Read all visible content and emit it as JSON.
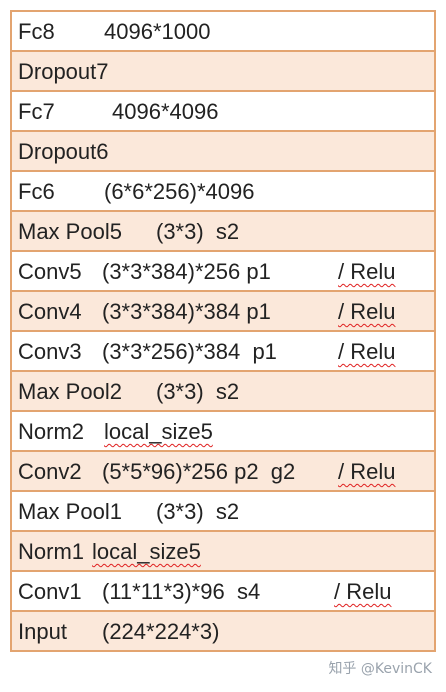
{
  "layers": [
    {
      "name": "Fc8",
      "params": "4096*1000",
      "act": ""
    },
    {
      "name": "Dropout7",
      "params": "",
      "act": ""
    },
    {
      "name": "Fc7",
      "params": "4096*4096",
      "act": ""
    },
    {
      "name": "Dropout6",
      "params": "",
      "act": ""
    },
    {
      "name": "Fc6",
      "params": "(6*6*256)*4096",
      "act": ""
    },
    {
      "name": "Max Pool5",
      "params": "(3*3)  s2",
      "act": ""
    },
    {
      "name": "Conv5",
      "params": "(3*3*384)*256 p1",
      "act": "/ Relu"
    },
    {
      "name": "Conv4",
      "params": "(3*3*384)*384 p1",
      "act": "/ Relu"
    },
    {
      "name": "Conv3",
      "params": "(3*3*256)*384  p1",
      "act": "/ Relu"
    },
    {
      "name": "Max Pool2",
      "params": "(3*3)  s2",
      "act": ""
    },
    {
      "name": "Norm2",
      "params": "local_size5",
      "act": ""
    },
    {
      "name": "Conv2",
      "params": "(5*5*96)*256 p2  g2",
      "act": "/ Relu"
    },
    {
      "name": "Max Pool1",
      "params": "(3*3)  s2",
      "act": ""
    },
    {
      "name": "Norm1",
      "params": "local_size5",
      "act": ""
    },
    {
      "name": "Conv1",
      "params": "(11*11*3)*96  s4",
      "act": "/ Relu"
    },
    {
      "name": "Input",
      "params": "(224*224*3)",
      "act": ""
    }
  ],
  "watermark": "知乎 @KevinCK",
  "colors": {
    "border": "#e3a470",
    "band": "#fbe8da",
    "spell_underline": "#e02020"
  }
}
